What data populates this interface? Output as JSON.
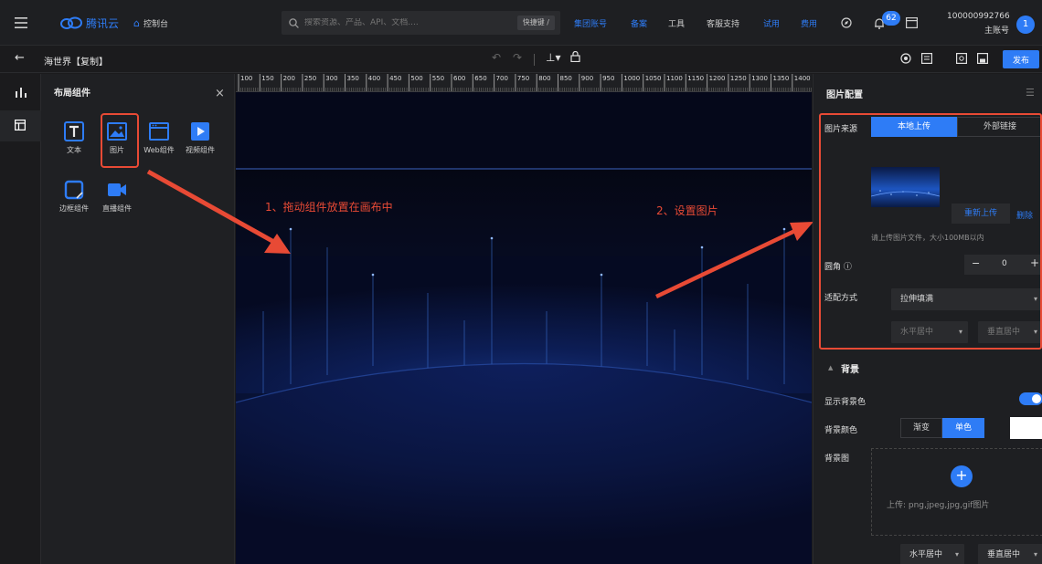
{
  "topnav": {
    "brand": "腾讯云",
    "console": "控制台",
    "search_placeholder": "搜索资源、产品、API、文档....",
    "shortcut": "快捷键 /",
    "links": [
      "集团账号",
      "备案",
      "工具",
      "客服支持",
      "试用",
      "费用"
    ],
    "notification_count": "62",
    "account_id": "100000992766",
    "account_role": "主账号",
    "avatar_text": "1"
  },
  "subbar": {
    "back_arrow": "←",
    "project_title": "海世界【复制】",
    "publish_label": "发布"
  },
  "panel": {
    "title": "布局组件",
    "close": "×",
    "components": [
      {
        "label": "文本",
        "icon": "text-icon"
      },
      {
        "label": "图片",
        "icon": "image-icon"
      },
      {
        "label": "Web组件",
        "icon": "web-icon"
      },
      {
        "label": "视频组件",
        "icon": "video-icon"
      },
      {
        "label": "边框组件",
        "icon": "border-icon"
      },
      {
        "label": "直播组件",
        "icon": "live-icon"
      }
    ]
  },
  "ruler_ticks": [
    "100",
    "150",
    "200",
    "250",
    "300",
    "350",
    "400",
    "450",
    "500",
    "550",
    "600",
    "650",
    "700",
    "750",
    "800",
    "850",
    "900",
    "950",
    "1000",
    "1050",
    "1100",
    "1150",
    "1200",
    "1250",
    "1300",
    "1350",
    "1400"
  ],
  "annotations": {
    "step1": "1、拖动组件放置在画布中",
    "step2": "2、设置图片"
  },
  "config": {
    "title": "图片配置",
    "source_label": "图片来源",
    "source_local": "本地上传",
    "source_external": "外部链接",
    "reupload": "重新上传",
    "delete": "删除",
    "upload_hint": "请上传图片文件，大小100MB以内",
    "radius_label": "圆角",
    "radius_info": "ⓘ",
    "radius_minus": "−",
    "radius_value": "0",
    "radius_plus": "+",
    "fit_label": "适配方式",
    "fit_value": "拉伸填满",
    "h_align": "水平居中",
    "v_align": "垂直居中",
    "bg_section": "背景",
    "bg_show_label": "显示背景色",
    "bg_color_label": "背景颜色",
    "bg_gradient": "渐变",
    "bg_solid": "单色",
    "bg_image_label": "背景图",
    "bg_upload_hint": "上传: png,jpeg,jpg,gif图片",
    "bg_h_align": "水平居中",
    "bg_v_align": "垂直居中"
  },
  "colors": {
    "accent": "#2e7cf6",
    "annotation": "#e84a35"
  }
}
